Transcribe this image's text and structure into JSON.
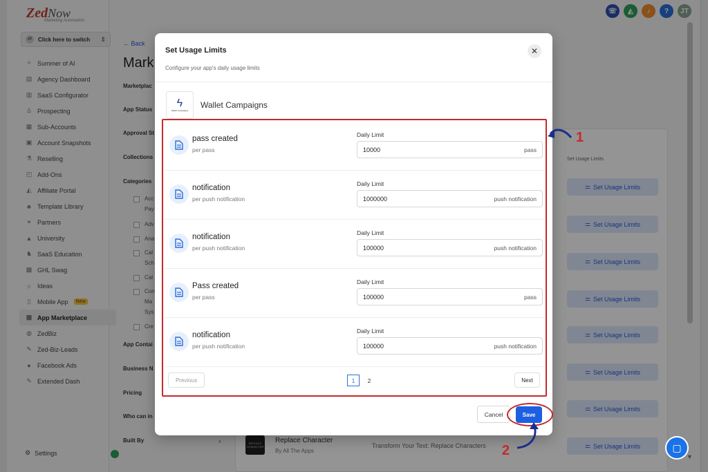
{
  "brand": {
    "name_part1": "Zed",
    "name_part2": "Now",
    "tagline": "Marketing Automation"
  },
  "switcher": {
    "label": "Click here to switch"
  },
  "sidebar": {
    "items": [
      {
        "label": "Summer of AI",
        "icon": "sparkle-icon",
        "glyph": "✧"
      },
      {
        "label": "Agency Dashboard",
        "icon": "dashboard-icon",
        "glyph": "▤"
      },
      {
        "label": "SaaS Configurator",
        "icon": "chart-icon",
        "glyph": "▥"
      },
      {
        "label": "Prospecting",
        "icon": "user-search-icon",
        "glyph": "♙"
      },
      {
        "label": "Sub-Accounts",
        "icon": "building-icon",
        "glyph": "▦"
      },
      {
        "label": "Account Snapshots",
        "icon": "snapshot-icon",
        "glyph": "▣"
      },
      {
        "label": "Reselling",
        "icon": "flask-icon",
        "glyph": "⚗"
      },
      {
        "label": "Add-Ons",
        "icon": "bag-icon",
        "glyph": "◰"
      },
      {
        "label": "Affiliate Portal",
        "icon": "megaphone-icon",
        "glyph": "◭"
      },
      {
        "label": "Template Library",
        "icon": "shapes-icon",
        "glyph": "♣"
      },
      {
        "label": "Partners",
        "icon": "handshake-icon",
        "glyph": "⚭"
      },
      {
        "label": "University",
        "icon": "graduation-icon",
        "glyph": "▲"
      },
      {
        "label": "SaaS Education",
        "icon": "education-icon",
        "glyph": "♞"
      },
      {
        "label": "GHL Swag",
        "icon": "shirt-icon",
        "glyph": "▩"
      },
      {
        "label": "Ideas",
        "icon": "lightbulb-icon",
        "glyph": "☼"
      },
      {
        "label": "Mobile App",
        "icon": "phone-icon",
        "glyph": "▯",
        "badge": "New"
      },
      {
        "label": "App Marketplace",
        "icon": "grid-icon",
        "glyph": "▦",
        "active": true
      },
      {
        "label": "ZedBiz",
        "icon": "globe-icon",
        "glyph": "◍"
      },
      {
        "label": "Zed-Biz-Leads",
        "icon": "wrench-icon",
        "glyph": "✎"
      },
      {
        "label": "Facebook Ads",
        "icon": "facebook-icon",
        "glyph": "●"
      },
      {
        "label": "Extended Dash",
        "icon": "wrench-icon",
        "glyph": "✎"
      }
    ],
    "settings_label": "Settings"
  },
  "topbar": {
    "avatar_initials": "JT",
    "help": "?"
  },
  "background": {
    "back": "Back",
    "heading": "Mark",
    "filters": [
      "Marketplac",
      "App Status",
      "Approval St",
      "Collections",
      "Categories",
      "App Contai",
      "Business N",
      "Pricing",
      "Who can in",
      "Built By"
    ],
    "category_checks": [
      "Acc",
      "Pay",
      "Adv",
      "Ana",
      "Cal",
      "Sch",
      "Cal",
      "Con",
      "Ma",
      "Sys",
      "Cre"
    ],
    "table_header_limits": "Set Usage Limits",
    "usage_button": "Set Usage Limits",
    "row": {
      "title": "Replace Character",
      "subtitle": "By All The Apps",
      "description": "Transform Your Text: Replace Characters",
      "thumb": "REPLACE CHARACTER"
    }
  },
  "modal": {
    "title": "Set Usage Limits",
    "subtitle": "Configure your app's daily usage limits",
    "app_name": "Wallet Campaigns",
    "app_logo_text": "Wallet Campaigns",
    "limits": [
      {
        "name": "pass created",
        "unit": "per pass",
        "label": "Daily Limit",
        "value": "10000",
        "suffix": "pass"
      },
      {
        "name": "notification",
        "unit": "per push notification",
        "label": "Daily Limit",
        "value": "1000000",
        "suffix": "push notification"
      },
      {
        "name": "notification",
        "unit": "per push notification",
        "label": "Daily Limit",
        "value": "100000",
        "suffix": "push notification"
      },
      {
        "name": "Pass created",
        "unit": "per pass",
        "label": "Daily Limit",
        "value": "100000",
        "suffix": "pass"
      },
      {
        "name": "notification",
        "unit": "per push notification",
        "label": "Daily Limit",
        "value": "100000",
        "suffix": "push notification"
      }
    ],
    "pagination": {
      "previous": "Previous",
      "next": "Next",
      "pages": [
        "1",
        "2"
      ],
      "current": "1"
    },
    "cancel": "Cancel",
    "save": "Save"
  },
  "annotations": {
    "step1": "1",
    "step2": "2"
  },
  "colors": {
    "accent": "#1d5fe0",
    "highlight": "#c62828",
    "active_green": "#2e9f5a"
  }
}
